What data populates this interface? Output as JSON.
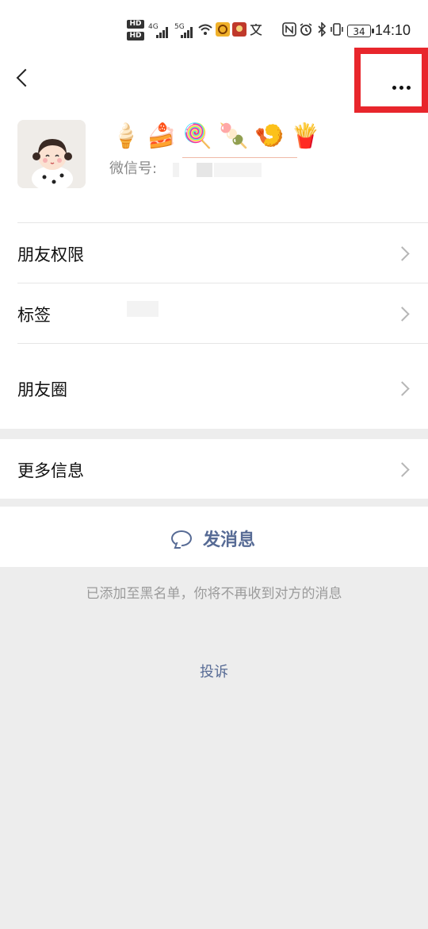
{
  "status_bar": {
    "hd1": "HD 1",
    "hd2": "HD 2",
    "net1": "4G",
    "net2": "5G",
    "battery": "34",
    "time": "14:10"
  },
  "header": {
    "back_icon": "chevron-left-icon",
    "more_icon": "more-horizontal-icon",
    "highlight_color": "#e8262c"
  },
  "profile": {
    "nickname_emojis": "🍦🍰🍭🍡🍤🍟",
    "wechat_id_label": "微信号:"
  },
  "menu": {
    "friend_permissions": "朋友权限",
    "tags": "标签",
    "moments": "朋友圈",
    "more_info": "更多信息"
  },
  "actions": {
    "send_message": "发消息",
    "message_icon": "chat-bubble-icon",
    "accent_color": "#576b95"
  },
  "blacklist_notice": "已添加至黑名单，你将不再收到对方的消息",
  "complain": "投诉"
}
